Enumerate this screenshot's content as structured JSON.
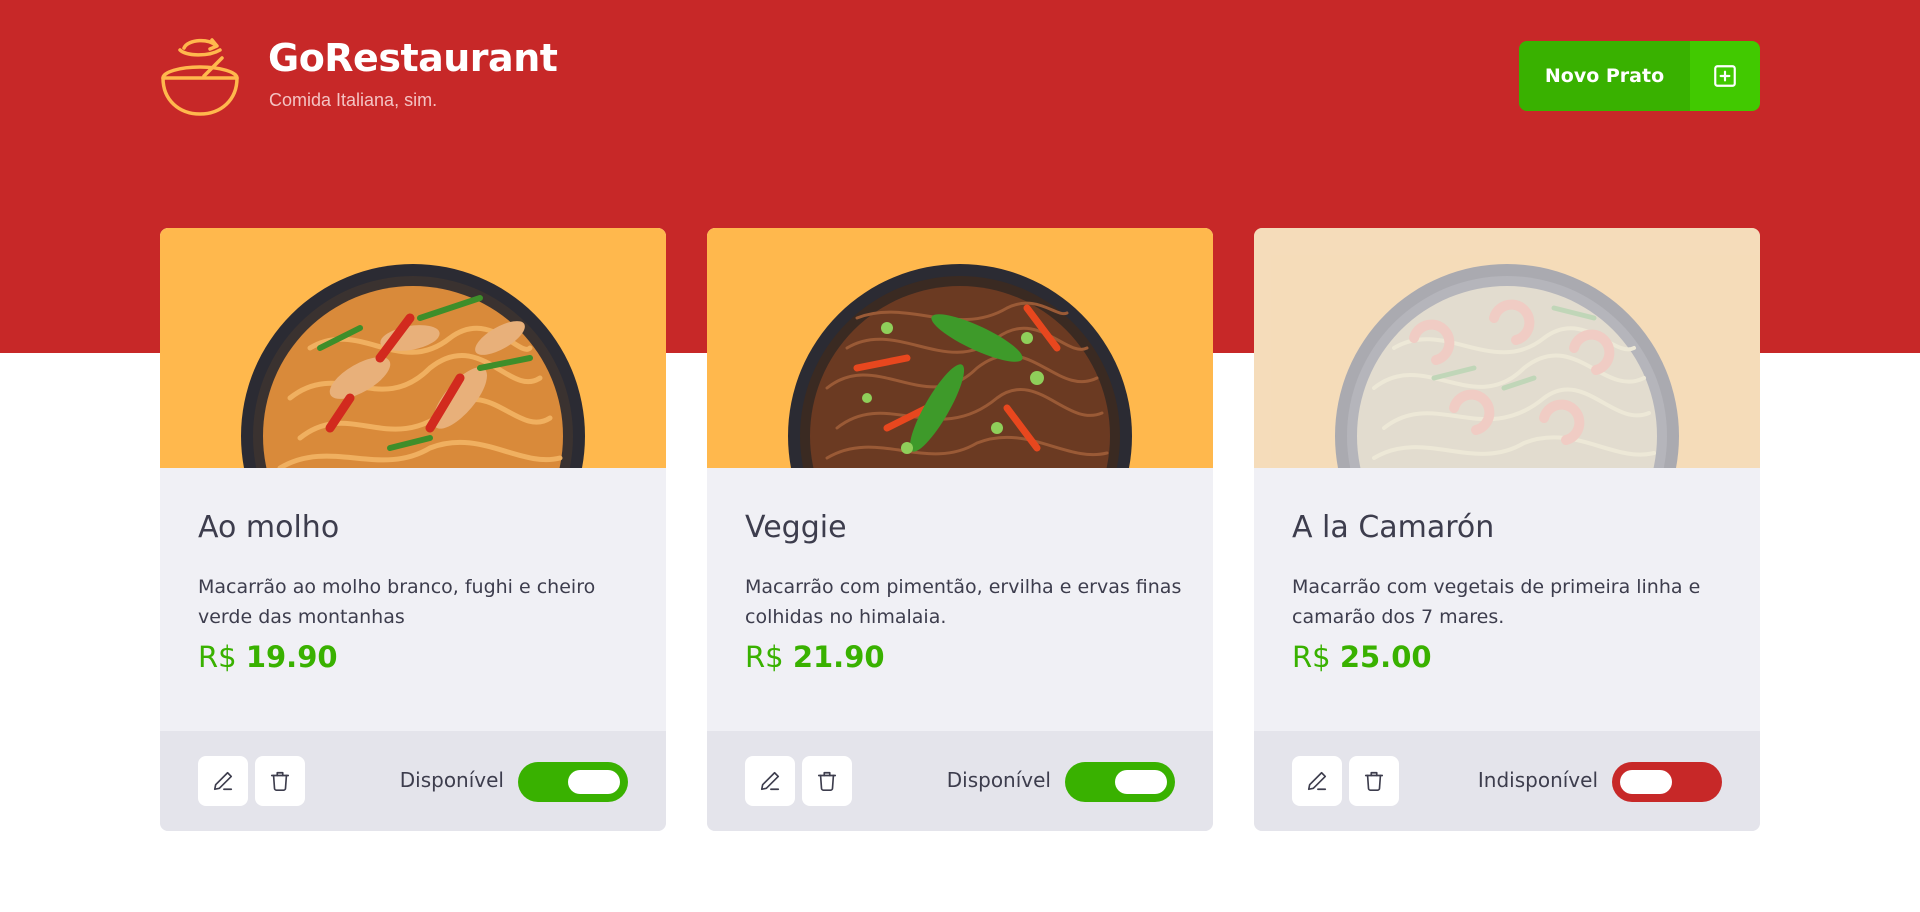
{
  "header": {
    "brand_title": "GoRestaurant",
    "brand_subtitle": "Comida Italiana, sim.",
    "new_button_label": "Novo Prato",
    "new_button_icon": "plus-square-icon"
  },
  "colors": {
    "header_red": "#c72828",
    "green": "#39b100",
    "green_light": "#41c900",
    "image_bg": "#ffb84d",
    "card_bg": "#f0f0f5",
    "footer_bg": "#e4e4eb",
    "text": "#3d3d4d",
    "toggle_off": "#c72828"
  },
  "foods": [
    {
      "name": "Ao molho",
      "description": "Macarrão ao molho branco, fughi e cheiro verde das montanhas",
      "currency": "R$",
      "price": "19.90",
      "status_label": "Disponível",
      "available": true,
      "image": "pasta-chicken-bowl"
    },
    {
      "name": "Veggie",
      "description": "Macarrão com pimentão, ervilha e ervas finas colhidas no himalaia.",
      "currency": "R$",
      "price": "21.90",
      "status_label": "Disponível",
      "available": true,
      "image": "pasta-veggie-bowl"
    },
    {
      "name": "A la Camarón",
      "description": "Macarrão com vegetais de primeira linha e camarão dos 7 mares.",
      "currency": "R$",
      "price": "25.00",
      "status_label": "Indisponível",
      "available": false,
      "image": "pasta-shrimp-bowl"
    }
  ]
}
